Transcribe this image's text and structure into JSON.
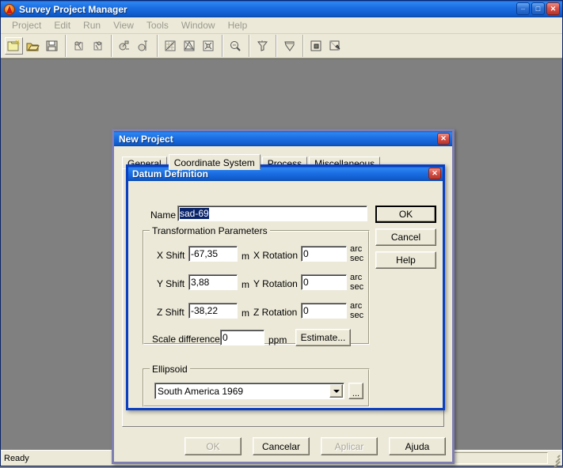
{
  "app": {
    "title": "Survey Project Manager",
    "icon": "app-logo-icon",
    "window_buttons": {
      "minimize": "_",
      "maximize": "□",
      "close": "✕"
    },
    "menu": [
      "Project",
      "Edit",
      "Run",
      "View",
      "Tools",
      "Window",
      "Help"
    ],
    "toolbar": [
      {
        "name": "new-project-icon",
        "group": 0
      },
      {
        "name": "open-project-icon",
        "group": 0
      },
      {
        "name": "save-project-icon",
        "group": 0
      },
      {
        "name": "import-data-icon",
        "group": 1
      },
      {
        "name": "export-data-icon",
        "group": 1
      },
      {
        "name": "process-baseline-icon",
        "group": 2
      },
      {
        "name": "process-network-icon",
        "group": 2
      },
      {
        "name": "adjustment-icon",
        "group": 3
      },
      {
        "name": "loop-closure-icon",
        "group": 3
      },
      {
        "name": "transform-icon",
        "group": 3
      },
      {
        "name": "analysis-icon",
        "group": 4
      },
      {
        "name": "filter-icon",
        "group": 5
      },
      {
        "name": "report-icon",
        "group": 6
      },
      {
        "name": "plot-icon",
        "group": 7
      },
      {
        "name": "map-view-icon",
        "group": 7
      }
    ],
    "statusbar": {
      "message": "Ready",
      "panel1": "",
      "panel2": ""
    }
  },
  "new_project_dialog": {
    "title": "New Project",
    "close_label": "✕",
    "tabs": [
      {
        "label": "General",
        "active": false
      },
      {
        "label": "Coordinate System",
        "active": true
      },
      {
        "label": "Process",
        "active": false
      },
      {
        "label": "Miscellaneous",
        "active": false
      }
    ],
    "buttons": [
      {
        "label": "OK",
        "disabled": true
      },
      {
        "label": "Cancelar",
        "disabled": false
      },
      {
        "label": "Aplicar",
        "disabled": true
      },
      {
        "label": "Ajuda",
        "disabled": false
      }
    ]
  },
  "datum_dialog": {
    "title": "Datum Definition",
    "close_label": "✕",
    "name_label": "Name",
    "name_value": "sad-69",
    "buttons": {
      "ok": "OK",
      "cancel": "Cancel",
      "help": "Help"
    },
    "transformation": {
      "group_title": "Transformation Parameters",
      "rows": [
        {
          "shift_label": "X Shift",
          "shift_value": "-67,35",
          "shift_unit": "m",
          "rot_label": "X Rotation",
          "rot_value": "0",
          "rot_unit_top": "arc",
          "rot_unit_bottom": "sec"
        },
        {
          "shift_label": "Y Shift",
          "shift_value": "3,88",
          "shift_unit": "m",
          "rot_label": "Y Rotation",
          "rot_value": "0",
          "rot_unit_top": "arc",
          "rot_unit_bottom": "sec"
        },
        {
          "shift_label": "Z Shift",
          "shift_value": "-38,22",
          "shift_unit": "m",
          "rot_label": "Z Rotation",
          "rot_value": "0",
          "rot_unit_top": "arc",
          "rot_unit_bottom": "sec"
        }
      ],
      "scale_label": "Scale difference",
      "scale_value": "0",
      "scale_unit": "ppm",
      "estimate_label": "Estimate..."
    },
    "ellipsoid": {
      "group_title": "Ellipsoid",
      "selected": "South America 1969",
      "browse_label": "..."
    }
  },
  "colors": {
    "titlebar_blue": "#0f59c9",
    "dialog_face": "#ece9d8",
    "active_border": "#0a3fc0",
    "inactive_border": "#7e7eb0",
    "desktop": "#808080",
    "selection": "#0a246a"
  }
}
